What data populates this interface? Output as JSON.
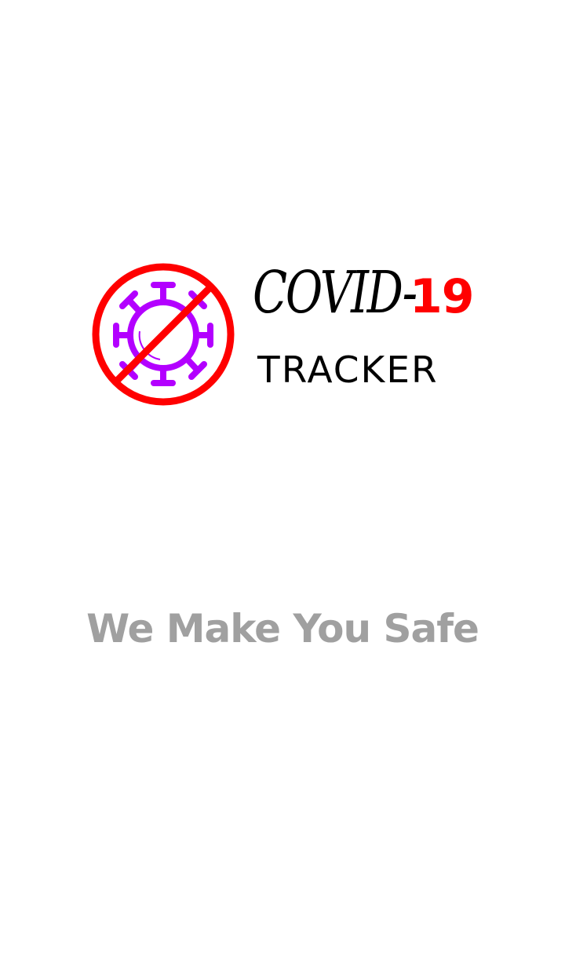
{
  "splash": {
    "logo": {
      "icon": "no-virus-icon",
      "title_main": "COVID-",
      "title_number": "19",
      "subtitle": "TRACKER"
    },
    "tagline": "We Make You Safe"
  },
  "colors": {
    "background": "#ffffff",
    "prohibition_red": "#ff0000",
    "virus_purple": "#b300ff",
    "title_text": "#000000",
    "tagline_text": "#a0a0a0"
  }
}
